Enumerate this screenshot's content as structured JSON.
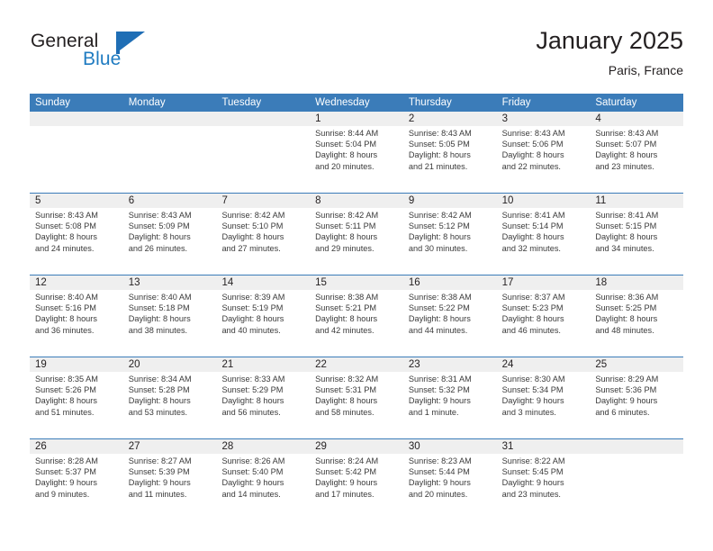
{
  "brand": {
    "name_part1": "General",
    "name_part2": "Blue",
    "logo_icon": "flag-triangle-icon"
  },
  "header": {
    "title": "January 2025",
    "subtitle": "Paris, France"
  },
  "calendar": {
    "weekdays": [
      "Sunday",
      "Monday",
      "Tuesday",
      "Wednesday",
      "Thursday",
      "Friday",
      "Saturday"
    ],
    "header_bg": "#3b7cb9",
    "band_bg": "#efefef",
    "weeks": [
      [
        {
          "day": "",
          "sunrise": "",
          "sunset": "",
          "daylight1": "",
          "daylight2": ""
        },
        {
          "day": "",
          "sunrise": "",
          "sunset": "",
          "daylight1": "",
          "daylight2": ""
        },
        {
          "day": "",
          "sunrise": "",
          "sunset": "",
          "daylight1": "",
          "daylight2": ""
        },
        {
          "day": "1",
          "sunrise": "Sunrise: 8:44 AM",
          "sunset": "Sunset: 5:04 PM",
          "daylight1": "Daylight: 8 hours",
          "daylight2": "and 20 minutes."
        },
        {
          "day": "2",
          "sunrise": "Sunrise: 8:43 AM",
          "sunset": "Sunset: 5:05 PM",
          "daylight1": "Daylight: 8 hours",
          "daylight2": "and 21 minutes."
        },
        {
          "day": "3",
          "sunrise": "Sunrise: 8:43 AM",
          "sunset": "Sunset: 5:06 PM",
          "daylight1": "Daylight: 8 hours",
          "daylight2": "and 22 minutes."
        },
        {
          "day": "4",
          "sunrise": "Sunrise: 8:43 AM",
          "sunset": "Sunset: 5:07 PM",
          "daylight1": "Daylight: 8 hours",
          "daylight2": "and 23 minutes."
        }
      ],
      [
        {
          "day": "5",
          "sunrise": "Sunrise: 8:43 AM",
          "sunset": "Sunset: 5:08 PM",
          "daylight1": "Daylight: 8 hours",
          "daylight2": "and 24 minutes."
        },
        {
          "day": "6",
          "sunrise": "Sunrise: 8:43 AM",
          "sunset": "Sunset: 5:09 PM",
          "daylight1": "Daylight: 8 hours",
          "daylight2": "and 26 minutes."
        },
        {
          "day": "7",
          "sunrise": "Sunrise: 8:42 AM",
          "sunset": "Sunset: 5:10 PM",
          "daylight1": "Daylight: 8 hours",
          "daylight2": "and 27 minutes."
        },
        {
          "day": "8",
          "sunrise": "Sunrise: 8:42 AM",
          "sunset": "Sunset: 5:11 PM",
          "daylight1": "Daylight: 8 hours",
          "daylight2": "and 29 minutes."
        },
        {
          "day": "9",
          "sunrise": "Sunrise: 8:42 AM",
          "sunset": "Sunset: 5:12 PM",
          "daylight1": "Daylight: 8 hours",
          "daylight2": "and 30 minutes."
        },
        {
          "day": "10",
          "sunrise": "Sunrise: 8:41 AM",
          "sunset": "Sunset: 5:14 PM",
          "daylight1": "Daylight: 8 hours",
          "daylight2": "and 32 minutes."
        },
        {
          "day": "11",
          "sunrise": "Sunrise: 8:41 AM",
          "sunset": "Sunset: 5:15 PM",
          "daylight1": "Daylight: 8 hours",
          "daylight2": "and 34 minutes."
        }
      ],
      [
        {
          "day": "12",
          "sunrise": "Sunrise: 8:40 AM",
          "sunset": "Sunset: 5:16 PM",
          "daylight1": "Daylight: 8 hours",
          "daylight2": "and 36 minutes."
        },
        {
          "day": "13",
          "sunrise": "Sunrise: 8:40 AM",
          "sunset": "Sunset: 5:18 PM",
          "daylight1": "Daylight: 8 hours",
          "daylight2": "and 38 minutes."
        },
        {
          "day": "14",
          "sunrise": "Sunrise: 8:39 AM",
          "sunset": "Sunset: 5:19 PM",
          "daylight1": "Daylight: 8 hours",
          "daylight2": "and 40 minutes."
        },
        {
          "day": "15",
          "sunrise": "Sunrise: 8:38 AM",
          "sunset": "Sunset: 5:21 PM",
          "daylight1": "Daylight: 8 hours",
          "daylight2": "and 42 minutes."
        },
        {
          "day": "16",
          "sunrise": "Sunrise: 8:38 AM",
          "sunset": "Sunset: 5:22 PM",
          "daylight1": "Daylight: 8 hours",
          "daylight2": "and 44 minutes."
        },
        {
          "day": "17",
          "sunrise": "Sunrise: 8:37 AM",
          "sunset": "Sunset: 5:23 PM",
          "daylight1": "Daylight: 8 hours",
          "daylight2": "and 46 minutes."
        },
        {
          "day": "18",
          "sunrise": "Sunrise: 8:36 AM",
          "sunset": "Sunset: 5:25 PM",
          "daylight1": "Daylight: 8 hours",
          "daylight2": "and 48 minutes."
        }
      ],
      [
        {
          "day": "19",
          "sunrise": "Sunrise: 8:35 AM",
          "sunset": "Sunset: 5:26 PM",
          "daylight1": "Daylight: 8 hours",
          "daylight2": "and 51 minutes."
        },
        {
          "day": "20",
          "sunrise": "Sunrise: 8:34 AM",
          "sunset": "Sunset: 5:28 PM",
          "daylight1": "Daylight: 8 hours",
          "daylight2": "and 53 minutes."
        },
        {
          "day": "21",
          "sunrise": "Sunrise: 8:33 AM",
          "sunset": "Sunset: 5:29 PM",
          "daylight1": "Daylight: 8 hours",
          "daylight2": "and 56 minutes."
        },
        {
          "day": "22",
          "sunrise": "Sunrise: 8:32 AM",
          "sunset": "Sunset: 5:31 PM",
          "daylight1": "Daylight: 8 hours",
          "daylight2": "and 58 minutes."
        },
        {
          "day": "23",
          "sunrise": "Sunrise: 8:31 AM",
          "sunset": "Sunset: 5:32 PM",
          "daylight1": "Daylight: 9 hours",
          "daylight2": "and 1 minute."
        },
        {
          "day": "24",
          "sunrise": "Sunrise: 8:30 AM",
          "sunset": "Sunset: 5:34 PM",
          "daylight1": "Daylight: 9 hours",
          "daylight2": "and 3 minutes."
        },
        {
          "day": "25",
          "sunrise": "Sunrise: 8:29 AM",
          "sunset": "Sunset: 5:36 PM",
          "daylight1": "Daylight: 9 hours",
          "daylight2": "and 6 minutes."
        }
      ],
      [
        {
          "day": "26",
          "sunrise": "Sunrise: 8:28 AM",
          "sunset": "Sunset: 5:37 PM",
          "daylight1": "Daylight: 9 hours",
          "daylight2": "and 9 minutes."
        },
        {
          "day": "27",
          "sunrise": "Sunrise: 8:27 AM",
          "sunset": "Sunset: 5:39 PM",
          "daylight1": "Daylight: 9 hours",
          "daylight2": "and 11 minutes."
        },
        {
          "day": "28",
          "sunrise": "Sunrise: 8:26 AM",
          "sunset": "Sunset: 5:40 PM",
          "daylight1": "Daylight: 9 hours",
          "daylight2": "and 14 minutes."
        },
        {
          "day": "29",
          "sunrise": "Sunrise: 8:24 AM",
          "sunset": "Sunset: 5:42 PM",
          "daylight1": "Daylight: 9 hours",
          "daylight2": "and 17 minutes."
        },
        {
          "day": "30",
          "sunrise": "Sunrise: 8:23 AM",
          "sunset": "Sunset: 5:44 PM",
          "daylight1": "Daylight: 9 hours",
          "daylight2": "and 20 minutes."
        },
        {
          "day": "31",
          "sunrise": "Sunrise: 8:22 AM",
          "sunset": "Sunset: 5:45 PM",
          "daylight1": "Daylight: 9 hours",
          "daylight2": "and 23 minutes."
        },
        {
          "day": "",
          "sunrise": "",
          "sunset": "",
          "daylight1": "",
          "daylight2": ""
        }
      ]
    ]
  }
}
